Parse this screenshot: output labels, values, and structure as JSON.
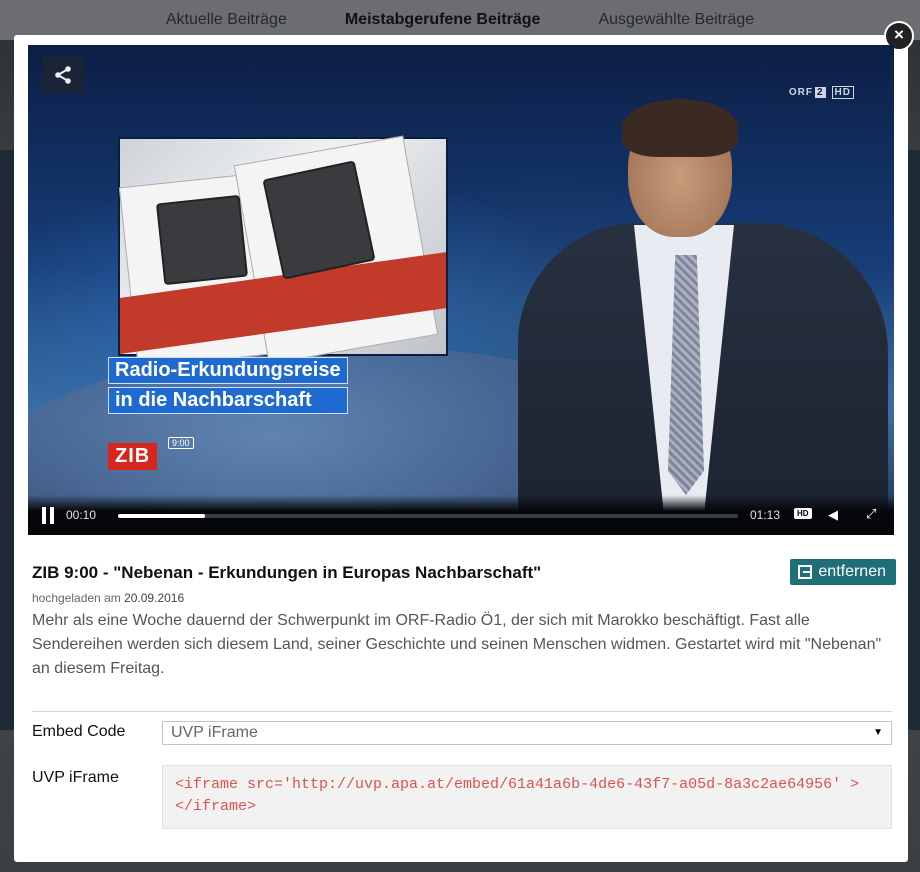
{
  "background_nav": {
    "items": [
      {
        "label": "Aktuelle Beiträge",
        "active": false
      },
      {
        "label": "Meistabgerufene Beiträge",
        "active": true
      },
      {
        "label": "Ausgewählte Beiträge",
        "active": false
      }
    ]
  },
  "video": {
    "overlay": {
      "lower_third": [
        "Radio-Erkundungsreise",
        "in die Nachbarschaft"
      ],
      "program_logo": "ZIB",
      "program_time": "9:00",
      "channel": {
        "prefix": "ORF",
        "number": "2",
        "hd": "HD"
      }
    },
    "controls": {
      "current_time": "00:10",
      "total_time": "01:13",
      "progress_fraction": 0.14,
      "hd_badge": "HD"
    }
  },
  "info": {
    "title": "ZIB 9:00 - \"Nebenan - Erkundungen in Europas Nachbarschaft\"",
    "uploaded_prefix": "hochgeladen am",
    "uploaded_date": "20.09.2016",
    "description": "Mehr als eine Woche dauernd der Schwerpunkt im ORF-Radio Ö1, der sich mit Marokko beschäftigt. Fast alle Sendereihen werden sich diesem Land, seiner Geschichte und seinen Menschen widmen. Gestartet wird mit \"Nebenan\" an diesem Freitag.",
    "remove_label": "entfernen"
  },
  "embed": {
    "label": "Embed Code",
    "selected": "UVP iFrame",
    "code_label": "UVP iFrame",
    "code": "<iframe src='http://uvp.apa.at/embed/61a41a6b-4de6-43f7-a05d-8a3c2ae64956' ></iframe>"
  },
  "colors": {
    "accent": "#1f6e78",
    "code_text": "#d9534f",
    "lower_third_bg": "#1f6ad1",
    "zib_red": "#d7261e"
  }
}
